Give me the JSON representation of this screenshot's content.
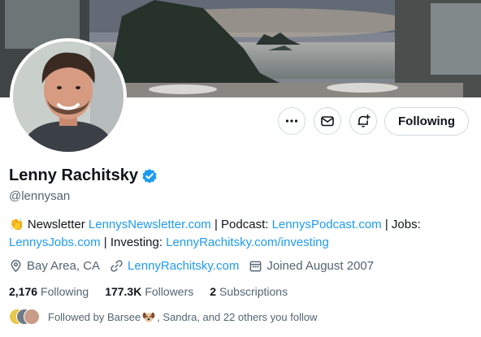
{
  "profile": {
    "name": "Lenny Rachitsky",
    "handle": "@lennysan",
    "bio": {
      "emoji": "👏",
      "newsletter_label": "Newsletter",
      "newsletter_link": "LennysNewsletter.com",
      "sep1": "|",
      "podcast_label": "Podcast:",
      "podcast_link": "LennysPodcast.com",
      "sep2": "|",
      "jobs_label": "Jobs:",
      "jobs_link": "LennysJobs.com",
      "sep3": "|",
      "investing_label": "Investing:",
      "investing_link": "LennyRachitsky.com/investing"
    },
    "location": "Bay Area, CA",
    "website": "LennyRachitsky.com",
    "joined": "Joined August 2007"
  },
  "actions": {
    "more_icon": "more-icon",
    "message_icon": "envelope-icon",
    "notify_icon": "bell-plus-icon",
    "follow_label": "Following"
  },
  "stats": {
    "following_count": "2,176",
    "following_label": "Following",
    "followers_count": "177.3K",
    "followers_label": "Followers",
    "subscriptions_count": "2",
    "subscriptions_label": "Subscriptions"
  },
  "followed_by": {
    "prefix": "Followed by Barsee",
    "suffix": ", Sandra, and 22 others you follow"
  },
  "colors": {
    "accent": "#1d9bf0",
    "text": "#0f1419",
    "muted": "#536471",
    "border": "#cfd9de"
  }
}
